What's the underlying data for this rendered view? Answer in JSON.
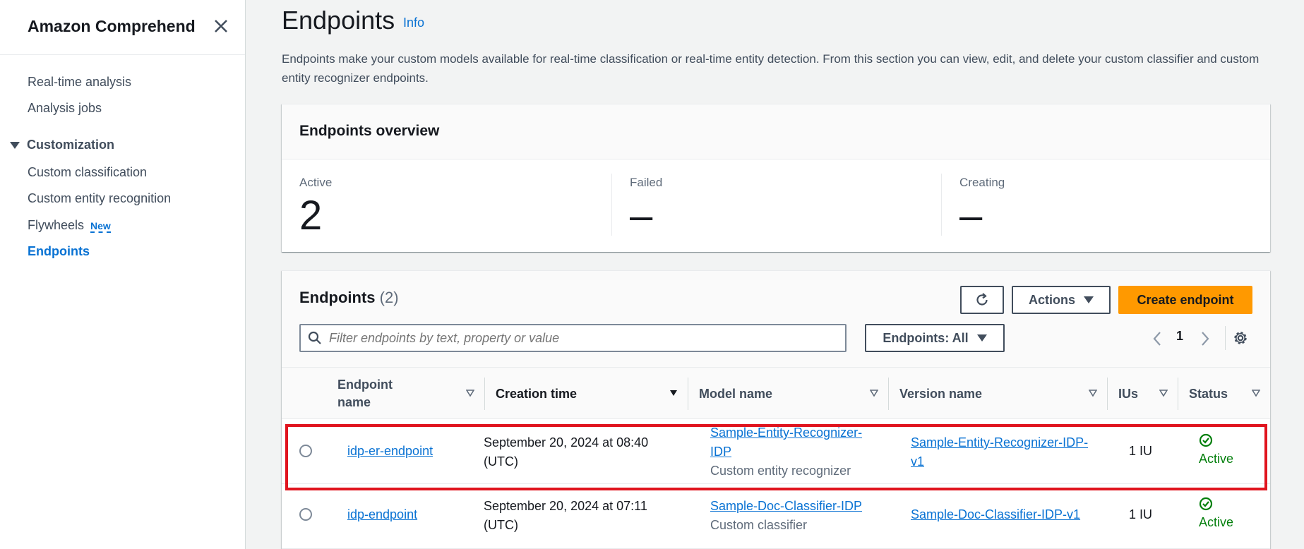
{
  "sidebar": {
    "title": "Amazon Comprehend",
    "items": [
      {
        "label": "Real-time analysis"
      },
      {
        "label": "Analysis jobs"
      }
    ],
    "section": {
      "label": "Customization",
      "items": [
        {
          "label": "Custom classification"
        },
        {
          "label": "Custom entity recognition"
        },
        {
          "label": "Flywheels",
          "badge": "New"
        },
        {
          "label": "Endpoints"
        }
      ]
    }
  },
  "header": {
    "title": "Endpoints",
    "info": "Info",
    "description": "Endpoints make your custom models available for real-time classification or real-time entity detection. From this section you can view, edit, and delete your custom classifier and custom entity recognizer endpoints."
  },
  "overview": {
    "title": "Endpoints overview",
    "stats": [
      {
        "label": "Active",
        "value": "2"
      },
      {
        "label": "Failed",
        "value": "–"
      },
      {
        "label": "Creating",
        "value": "–"
      }
    ]
  },
  "table": {
    "title": "Endpoints",
    "count": "(2)",
    "actions_label": "Actions",
    "create_label": "Create endpoint",
    "search_placeholder": "Filter endpoints by text, property or value",
    "filter_label": "Endpoints: All",
    "page": "1",
    "columns": [
      "Endpoint name",
      "Creation time",
      "Model name",
      "Version name",
      "IUs",
      "Status"
    ],
    "rows": [
      {
        "endpoint": "idp-er-endpoint",
        "created_1": "September 20, 2024 at 08:40",
        "created_2": "(UTC)",
        "model_1": "Sample-Entity-Recognizer-",
        "model_2": "IDP",
        "model_type": "Custom entity recognizer",
        "version_1": "Sample-Entity-Recognizer-IDP-",
        "version_2": "v1",
        "ius": "1 IU",
        "status": "Active"
      },
      {
        "endpoint": "idp-endpoint",
        "created_1": "September 20, 2024 at 07:11",
        "created_2": "(UTC)",
        "model_1": "Sample-Doc-Classifier-IDP",
        "model_type": "Custom classifier",
        "version_1": "Sample-Doc-Classifier-IDP-v1",
        "ius": "1 IU",
        "status": "Active"
      }
    ]
  },
  "colors": {
    "accent": "#0972d3",
    "primary_button": "#ff9900",
    "success": "#037f0c",
    "highlight": "#e0141e"
  }
}
